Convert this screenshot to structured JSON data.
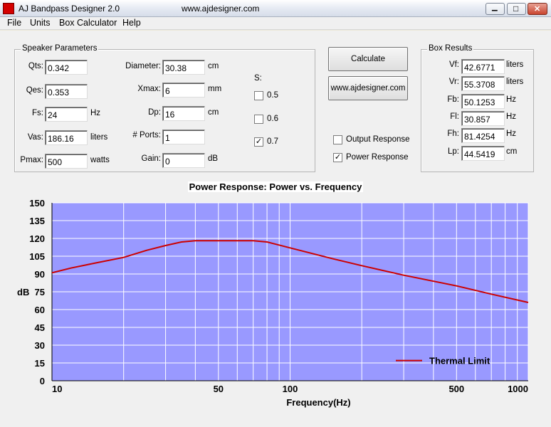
{
  "window": {
    "title": "AJ Bandpass Designer 2.0",
    "url": "www.ajdesigner.com",
    "minimize_glyph": "▁",
    "maximize_glyph": "□",
    "close_glyph": "✕"
  },
  "menu": [
    "File",
    "Units",
    "Box Calculator",
    "Help"
  ],
  "speaker_parameters": {
    "title": "Speaker Parameters",
    "left_fields": [
      {
        "label": "Qts:",
        "value": "0.342",
        "unit": ""
      },
      {
        "label": "Qes:",
        "value": "0.353",
        "unit": ""
      },
      {
        "label": "Fs:",
        "value": "24",
        "unit": "Hz"
      },
      {
        "label": "Vas:",
        "value": "186.16",
        "unit": "liters"
      },
      {
        "label": "Pmax:",
        "value": "500",
        "unit": "watts"
      }
    ],
    "right_fields": [
      {
        "label": "Diameter:",
        "value": "30.38",
        "unit": "cm"
      },
      {
        "label": "Xmax:",
        "value": "6",
        "unit": "mm"
      },
      {
        "label": "Dp:",
        "value": "16",
        "unit": "cm"
      },
      {
        "label": "# Ports:",
        "value": "1",
        "unit": ""
      },
      {
        "label": "Gain:",
        "value": "0",
        "unit": "dB"
      }
    ],
    "s_label": "S:",
    "s_options": [
      {
        "label": "0.5",
        "checked": false
      },
      {
        "label": "0.6",
        "checked": false
      },
      {
        "label": "0.7",
        "checked": true
      }
    ]
  },
  "buttons": {
    "calculate": "Calculate",
    "website": "www.ajdesigner.com"
  },
  "response_options": [
    {
      "label": "Output Response",
      "checked": false
    },
    {
      "label": "Power Response",
      "checked": true
    }
  ],
  "check_glyph": "✓",
  "box_results": {
    "title": "Box Results",
    "rows": [
      {
        "label": "Vf:",
        "value": "42.6771",
        "unit": "liters"
      },
      {
        "label": "Vr:",
        "value": "55.3708",
        "unit": "liters"
      },
      {
        "label": "Fb:",
        "value": "50.1253",
        "unit": "Hz"
      },
      {
        "label": "Fl:",
        "value": "30.857",
        "unit": "Hz"
      },
      {
        "label": "Fh:",
        "value": "81.4254",
        "unit": "Hz"
      },
      {
        "label": "Lp:",
        "value": "44.5419",
        "unit": "cm"
      }
    ]
  },
  "chart_data": {
    "type": "line",
    "title": "Power Response: Power vs. Frequency",
    "xlabel": "Frequency(Hz)",
    "ylabel": "dB",
    "x_scale": "log",
    "xlim": [
      10,
      1000
    ],
    "ylim": [
      0,
      150
    ],
    "x_ticks": [
      10,
      50,
      100,
      500,
      1000
    ],
    "y_ticks": [
      0,
      15,
      30,
      45,
      60,
      75,
      90,
      105,
      120,
      135,
      150
    ],
    "grid": true,
    "plot_bg": "#9999ff",
    "legend_position": "lower-right",
    "series": [
      {
        "name": "Thermal Limit",
        "color": "#cc0000",
        "x": [
          10,
          12,
          15,
          20,
          25,
          30,
          35,
          40,
          50,
          60,
          70,
          80,
          100,
          150,
          200,
          300,
          500,
          700,
          1000
        ],
        "y": [
          91,
          95,
          99,
          104,
          110,
          114,
          117,
          118,
          118,
          118,
          118,
          117,
          112,
          103,
          97,
          89,
          80,
          73,
          66
        ]
      }
    ]
  }
}
